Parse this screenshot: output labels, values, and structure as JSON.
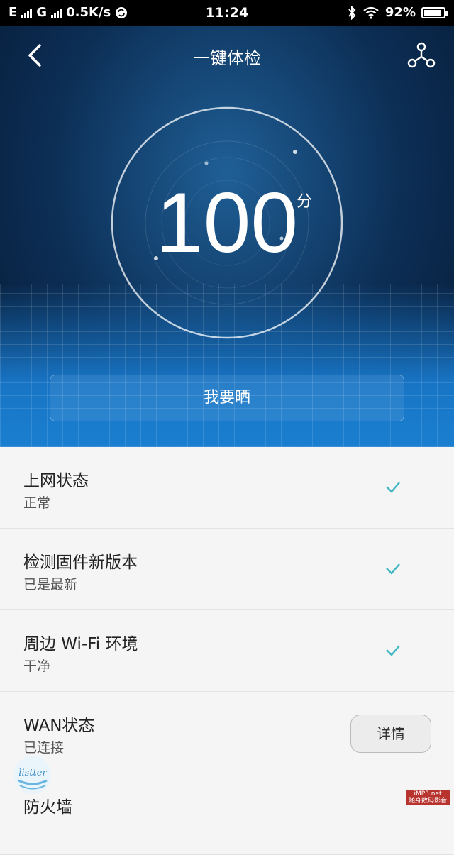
{
  "status_bar": {
    "carrier1": "E",
    "carrier2": "G",
    "speed": "0.5K/s",
    "time": "11:24",
    "battery_percent_text": "92%",
    "battery_level": 0.92,
    "icons": [
      "signal-icon",
      "sync-icon",
      "bluetooth-icon",
      "wifi-icon",
      "battery-icon"
    ]
  },
  "header": {
    "title": "一键体检",
    "back_icon": "chevron-left-icon",
    "share_icon": "share-icon"
  },
  "score": {
    "value": "100",
    "unit": "分"
  },
  "share_button_label": "我要晒",
  "checks": [
    {
      "title": "上网状态",
      "status": "正常",
      "result": "check"
    },
    {
      "title": "检测固件新版本",
      "status": "已是最新",
      "result": "check"
    },
    {
      "title": "周边 Wi-Fi 环境",
      "status": "干净",
      "result": "check"
    },
    {
      "title": "WAN状态",
      "status": "已连接",
      "action_label": "详情"
    },
    {
      "title": "防火墙",
      "status": ""
    }
  ],
  "watermarks": {
    "left_text": "listter",
    "right_line1": "iMP3.net",
    "right_line2": "随身数码影音"
  },
  "colors": {
    "accent_check": "#3fb7c4",
    "hero_dark": "#0c2e55",
    "hero_light": "#1a7fd0"
  }
}
